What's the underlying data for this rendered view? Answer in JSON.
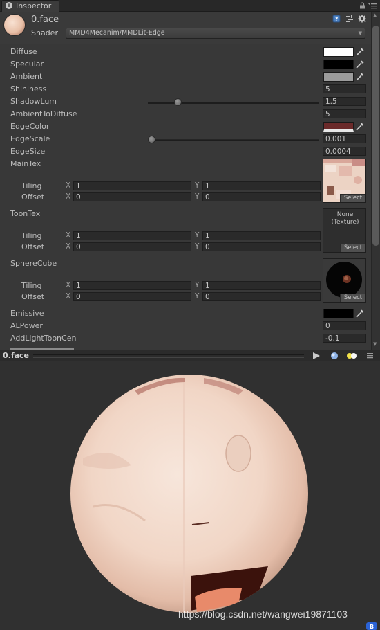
{
  "window": {
    "tab_title": "Inspector"
  },
  "material": {
    "name": "0.face",
    "shader_label": "Shader",
    "shader_value": "MMD4Mecanim/MMDLit-Edge"
  },
  "properties": {
    "diffuse": {
      "label": "Diffuse",
      "color": "#ffffff"
    },
    "specular": {
      "label": "Specular",
      "color": "#000000"
    },
    "ambient": {
      "label": "Ambient",
      "color": "#9b9b9b"
    },
    "shininess": {
      "label": "Shininess",
      "value": "5"
    },
    "shadowlum": {
      "label": "ShadowLum",
      "value": "1.5",
      "slider_fraction": 0.16
    },
    "ambienttodiffuse": {
      "label": "AmbientToDiffuse",
      "value": "5"
    },
    "edgecolor": {
      "label": "EdgeColor",
      "color": "#6b2a2a"
    },
    "edgescale": {
      "label": "EdgeScale",
      "value": "0.001",
      "slider_fraction": 0.0
    },
    "edgesize": {
      "label": "EdgeSize",
      "value": "0.0004"
    },
    "maintex": {
      "label": "MainTex",
      "tiling_label": "Tiling",
      "offset_label": "Offset",
      "tiling_x": "1",
      "tiling_y": "1",
      "offset_x": "0",
      "offset_y": "0",
      "select_label": "Select"
    },
    "toontex": {
      "label": "ToonTex",
      "none_text": "None",
      "type_text": "(Texture)",
      "tiling_label": "Tiling",
      "offset_label": "Offset",
      "tiling_x": "1",
      "tiling_y": "1",
      "offset_x": "0",
      "offset_y": "0",
      "select_label": "Select"
    },
    "spherecube": {
      "label": "SphereCube",
      "tiling_label": "Tiling",
      "offset_label": "Offset",
      "tiling_x": "1",
      "tiling_y": "1",
      "offset_x": "0",
      "offset_y": "0",
      "select_label": "Select"
    },
    "emissive": {
      "label": "Emissive",
      "color": "#000000"
    },
    "alpower": {
      "label": "ALPower",
      "value": "0"
    },
    "addlighttooncen": {
      "label": "AddLightToonCen",
      "value": "-0.1"
    }
  },
  "axis_labels": {
    "x": "X",
    "y": "Y"
  },
  "preview": {
    "title": "0.face"
  },
  "watermark": "https://blog.csdn.net/wangwei19871103",
  "icons": {
    "tab": "info-icon",
    "top_right": [
      "lock-icon",
      "menu-icon"
    ],
    "header": [
      "help-book-icon",
      "preset-icon",
      "gear-icon"
    ],
    "preview_bar": [
      "play-icon",
      "sphere-mesh-icon",
      "light-toggle-icon",
      "preview-menu-icon"
    ]
  }
}
